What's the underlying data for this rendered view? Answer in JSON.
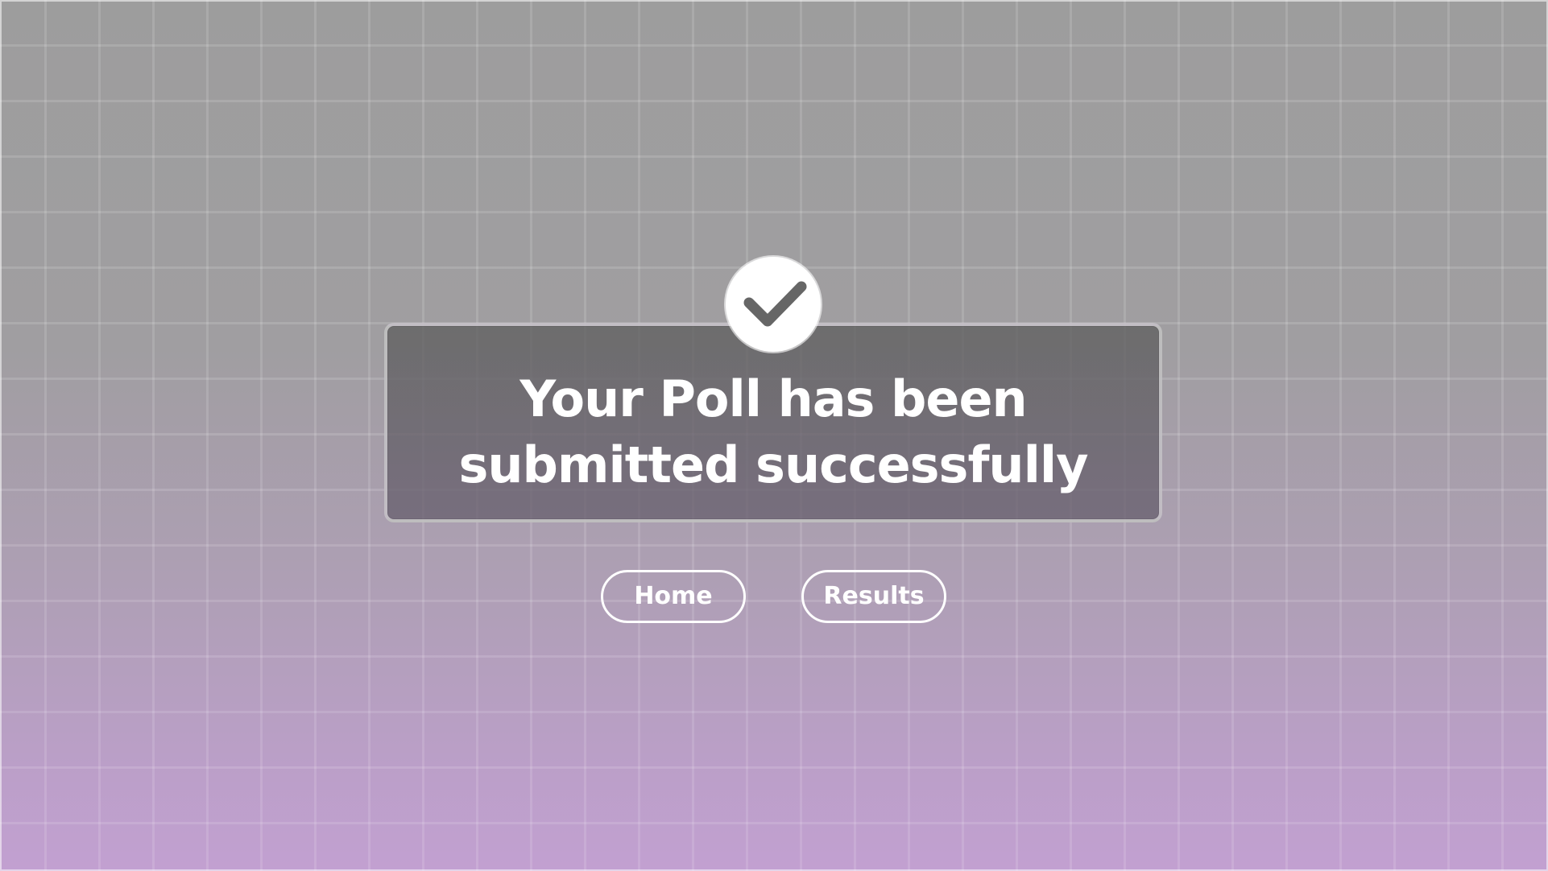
{
  "confirmation": {
    "title": "Your Poll has been submitted successfully",
    "status_icon": "check-circle-icon"
  },
  "actions": {
    "home_label": "Home",
    "results_label": "Results"
  },
  "colors": {
    "background_top": "#9d9d9d",
    "background_bottom": "#c2a0d1",
    "card": "#666666",
    "text": "#ffffff",
    "icon": "#666666"
  }
}
